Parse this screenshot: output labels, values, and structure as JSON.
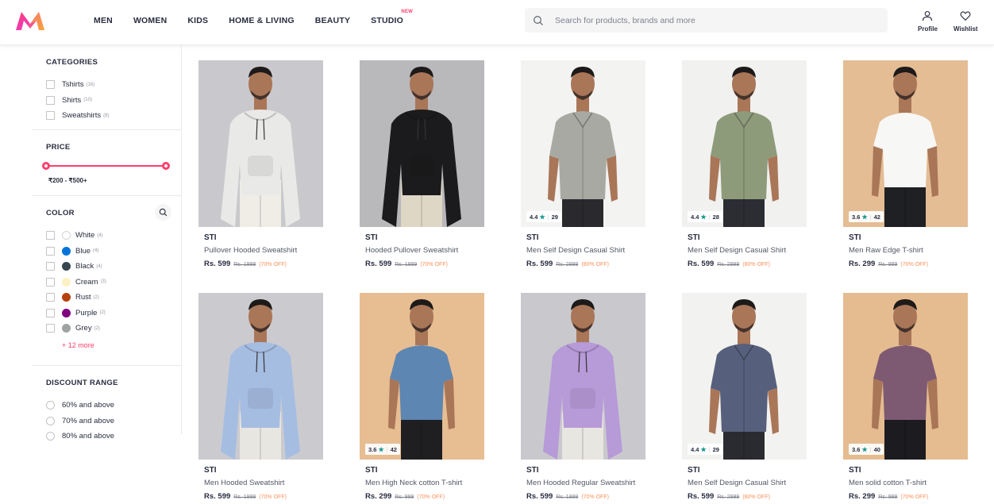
{
  "header": {
    "nav": [
      {
        "label": "MEN"
      },
      {
        "label": "WOMEN"
      },
      {
        "label": "KIDS"
      },
      {
        "label": "HOME & LIVING"
      },
      {
        "label": "BEAUTY"
      },
      {
        "label": "STUDIO",
        "badge": "NEW"
      }
    ],
    "search_placeholder": "Search for products, brands and more",
    "profile_label": "Profile",
    "wishlist_label": "Wishlist"
  },
  "filters": {
    "categories": {
      "title": "CATEGORIES",
      "items": [
        {
          "label": "Tshirts",
          "count": "(16)"
        },
        {
          "label": "Shirts",
          "count": "(10)"
        },
        {
          "label": "Sweatshirts",
          "count": "(8)"
        }
      ]
    },
    "price": {
      "title": "PRICE",
      "range": "₹200 - ₹500+"
    },
    "color": {
      "title": "COLOR",
      "items": [
        {
          "label": "White",
          "count": "(4)",
          "hex": "#ffffff"
        },
        {
          "label": "Blue",
          "count": "(4)",
          "hex": "#0074d9"
        },
        {
          "label": "Black",
          "count": "(4)",
          "hex": "#36454f"
        },
        {
          "label": "Cream",
          "count": "(3)",
          "hex": "#fdf1c4"
        },
        {
          "label": "Rust",
          "count": "(2)",
          "hex": "#b7410e"
        },
        {
          "label": "Purple",
          "count": "(2)",
          "hex": "#800080"
        },
        {
          "label": "Grey",
          "count": "(2)",
          "hex": "#9ea3a3"
        }
      ],
      "more": "+ 12 more"
    },
    "discount": {
      "title": "DISCOUNT RANGE",
      "items": [
        {
          "label": "60% and above"
        },
        {
          "label": "70% and above"
        },
        {
          "label": "80% and above"
        }
      ]
    }
  },
  "products": [
    {
      "brand": "STI",
      "name": "Pullover Hooded Sweatshirt",
      "price": "Rs. 599",
      "mrp": "Rs. 1999",
      "off": "(70% OFF)",
      "rating": "",
      "reviews": "",
      "bg": "#c9c9cd",
      "garment": "#e9e9e7",
      "pants": "#efede6",
      "type": "hoodie"
    },
    {
      "brand": "STI",
      "name": "Hooded Pullover Sweatshirt",
      "price": "Rs. 599",
      "mrp": "Rs. 1999",
      "off": "(70% OFF)",
      "rating": "",
      "reviews": "",
      "bg": "#b9b8bb",
      "garment": "#1b1b1d",
      "pants": "#ded7c6",
      "type": "hoodie"
    },
    {
      "brand": "STI",
      "name": "Men Self Design Casual Shirt",
      "price": "Rs. 599",
      "mrp": "Rs. 2999",
      "off": "(80% OFF)",
      "rating": "4.4",
      "reviews": "29",
      "bg": "#f3f3f2",
      "garment": "#a9a9a4",
      "pants": "#2a2a2e",
      "type": "shirt"
    },
    {
      "brand": "STI",
      "name": "Men Self Design Casual Shirt",
      "price": "Rs. 599",
      "mrp": "Rs. 2999",
      "off": "(80% OFF)",
      "rating": "4.4",
      "reviews": "28",
      "bg": "#f1f1ef",
      "garment": "#8d9b7b",
      "pants": "#2b2d33",
      "type": "shirt"
    },
    {
      "brand": "STI",
      "name": "Men Raw Edge T-shirt",
      "price": "Rs. 299",
      "mrp": "Rs. 999",
      "off": "(70% OFF)",
      "rating": "3.6",
      "reviews": "42",
      "bg": "#e4bd94",
      "garment": "#f7f7f6",
      "pants": "#1f2024",
      "type": "tee"
    },
    {
      "brand": "STI",
      "name": "Men Hooded Sweatshirt",
      "price": "Rs. 599",
      "mrp": "Rs. 1999",
      "off": "(70% OFF)",
      "rating": "",
      "reviews": "",
      "bg": "#cbcbcf",
      "garment": "#a6bde2",
      "pants": "#e8e6e0",
      "type": "hoodie"
    },
    {
      "brand": "STI",
      "name": "Men High Neck cotton T-shirt",
      "price": "Rs. 299",
      "mrp": "Rs. 999",
      "off": "(70% OFF)",
      "rating": "3.6",
      "reviews": "42",
      "bg": "#e7bd92",
      "garment": "#5d86b2",
      "pants": "#1f1f22",
      "type": "tee"
    },
    {
      "brand": "STI",
      "name": "Men Hooded Regular Sweatshirt",
      "price": "Rs. 599",
      "mrp": "Rs. 1999",
      "off": "(70% OFF)",
      "rating": "",
      "reviews": "",
      "bg": "#c9c9cd",
      "garment": "#b79ad8",
      "pants": "#e8e6e0",
      "type": "hoodie"
    },
    {
      "brand": "STI",
      "name": "Men Self Design Casual Shirt",
      "price": "Rs. 599",
      "mrp": "Rs. 2999",
      "off": "(80% OFF)",
      "rating": "4.4",
      "reviews": "29",
      "bg": "#f2f2f0",
      "garment": "#56607c",
      "pants": "#2a2b30",
      "type": "shirt"
    },
    {
      "brand": "STI",
      "name": "Men solid cotton T-shirt",
      "price": "Rs. 299",
      "mrp": "Rs. 999",
      "off": "(70% OFF)",
      "rating": "3.6",
      "reviews": "40",
      "bg": "#e5bc90",
      "garment": "#7e5a72",
      "pants": "#1c1c20",
      "type": "tee"
    }
  ]
}
